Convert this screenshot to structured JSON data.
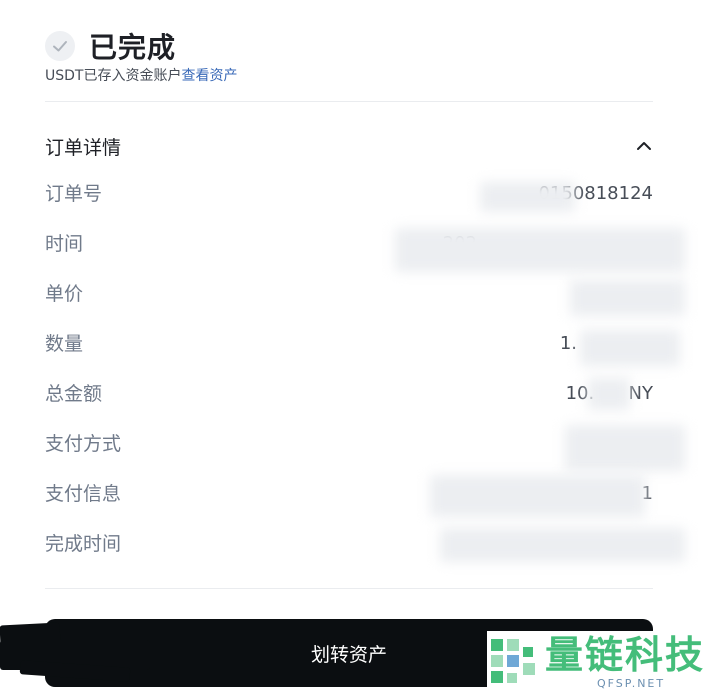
{
  "status": {
    "title": "已完成",
    "subtitle": "USDT已存入资金账户",
    "link": "查看资产"
  },
  "order": {
    "section_title": "订单详情",
    "rows": [
      {
        "label": "订单号",
        "value": "0150818124"
      },
      {
        "label": "时间",
        "value": "202"
      },
      {
        "label": "单价",
        "value": ""
      },
      {
        "label": "数量",
        "value": "1."
      },
      {
        "label": "总金额",
        "value": "10.      NY"
      },
      {
        "label": "支付方式",
        "value": ""
      },
      {
        "label": "支付信息",
        "value": "1"
      },
      {
        "label": "完成时间",
        "value": ""
      }
    ]
  },
  "action": {
    "transfer_label": "划转资产"
  },
  "watermark": {
    "text": "量链科技",
    "sub": "QFSP.NET"
  },
  "colors": {
    "accent_link": "#3a6ab8",
    "button_bg": "#0b0e11",
    "watermark_green": "#44bd7a"
  }
}
